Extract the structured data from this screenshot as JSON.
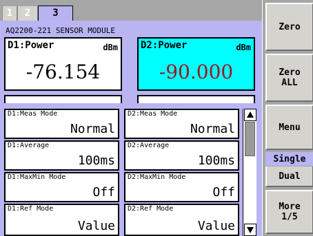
{
  "tabs": [
    {
      "label": "1",
      "active": false
    },
    {
      "label": "2",
      "active": false
    },
    {
      "label": "3",
      "active": true
    }
  ],
  "module": {
    "title": "AQ2200-221 SENSOR MODULE"
  },
  "displays": [
    {
      "label": "D1:Power",
      "unit": "dBm",
      "value": "-76.154",
      "highlight": false
    },
    {
      "label": "D2:Power",
      "unit": "dBm",
      "value": "-90.000",
      "highlight": true
    }
  ],
  "settings": [
    {
      "d1_label": "D1:Meas Mode",
      "d1_value": "Normal",
      "d2_label": "D2:Meas Mode",
      "d2_value": "Normal"
    },
    {
      "d1_label": "D1:Average",
      "d1_value": "100ms",
      "d2_label": "D2:Average",
      "d2_value": "100ms"
    },
    {
      "d1_label": "D1:MaxMin Mode",
      "d1_value": "Off",
      "d2_label": "D2:MaxMin Mode",
      "d2_value": "Off"
    },
    {
      "d1_label": "D1:Ref Mode",
      "d1_value": "Value",
      "d2_label": "D2:Ref Mode",
      "d2_value": "Value"
    }
  ],
  "softkeys": {
    "zero": "Zero",
    "zero_all": "Zero\nALL",
    "menu": "Menu",
    "single": "Single",
    "dual": "Dual",
    "more": "More\n1/5"
  },
  "colors": {
    "panel_bg": "#b8b5f2",
    "highlight_bg": "#00ffff",
    "highlight_value": "#a4141c",
    "softkey_bg": "#d5d3cd"
  },
  "icons": {
    "scroll_up": "triangle-up",
    "scroll_down": "triangle-down"
  }
}
